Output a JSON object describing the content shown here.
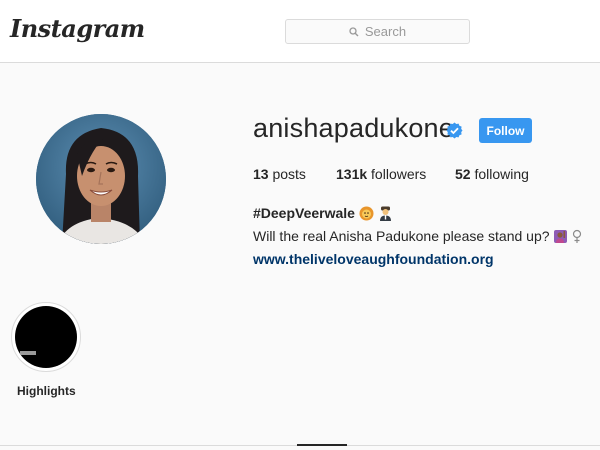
{
  "header": {
    "logo_text": "Instagram",
    "search_placeholder": "Search"
  },
  "profile": {
    "username": "anishapadukone",
    "verified": true,
    "follow_label": "Follow",
    "stats": {
      "posts_count": "13",
      "posts_label": "posts",
      "followers_count": "131k",
      "followers_label": "followers",
      "following_count": "52",
      "following_label": "following"
    },
    "bio": {
      "name_line": "#DeepVeerwale",
      "text": "Will the real Anisha Padukone please stand up?",
      "link": "www.theliveloveaughfoundation.org"
    }
  },
  "highlights": {
    "label": "Highlights"
  },
  "colors": {
    "accent": "#3897f0",
    "link": "#003569",
    "border": "#dbdbdb",
    "background": "#fafafa"
  },
  "icons": [
    "search-icon",
    "verified-badge-icon",
    "emoji-icons"
  ]
}
